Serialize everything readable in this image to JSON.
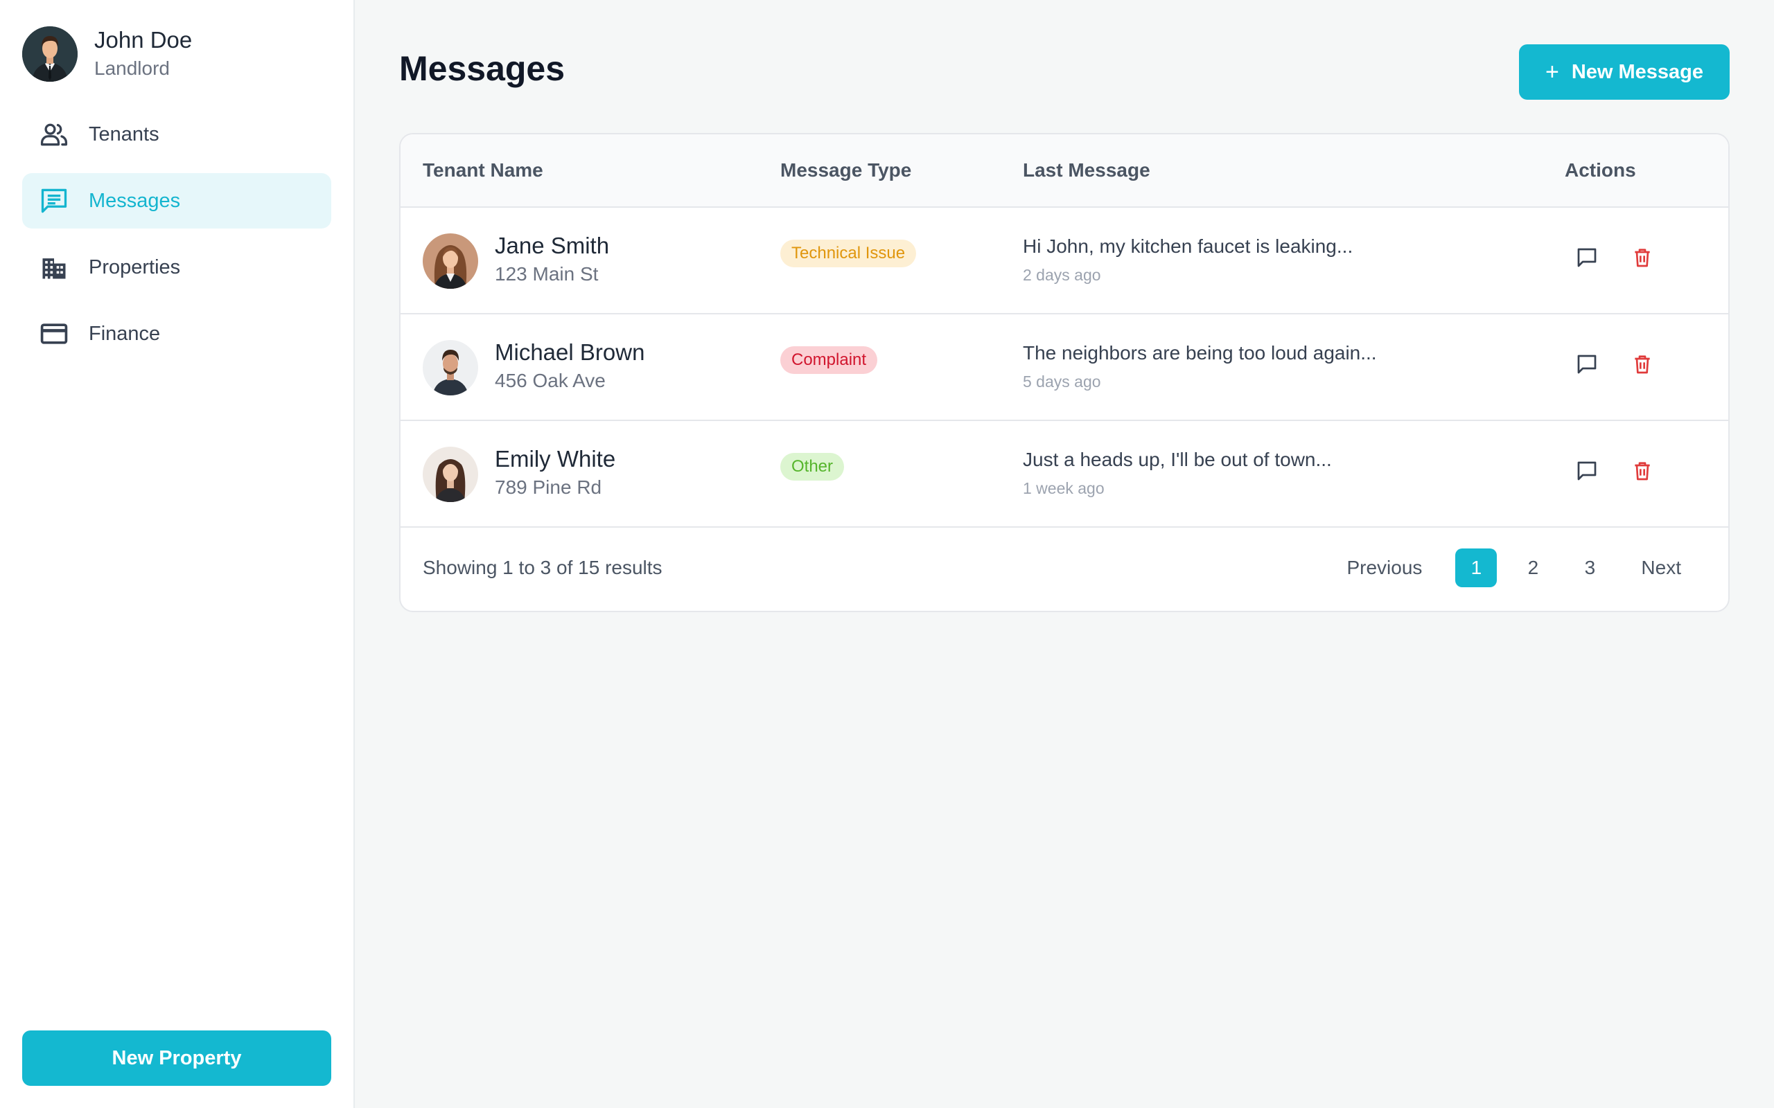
{
  "user": {
    "name": "John Doe",
    "role": "Landlord"
  },
  "sidebar": {
    "items": [
      {
        "label": "Tenants",
        "icon": "users-icon",
        "active": false
      },
      {
        "label": "Messages",
        "icon": "message-icon",
        "active": true
      },
      {
        "label": "Properties",
        "icon": "building-icon",
        "active": false
      },
      {
        "label": "Finance",
        "icon": "credit-card-icon",
        "active": false
      }
    ],
    "new_property_label": "New Property"
  },
  "header": {
    "title": "Messages",
    "new_message_label": "New Message"
  },
  "table": {
    "columns": [
      "Tenant Name",
      "Message Type",
      "Last Message",
      "Actions"
    ],
    "rows": [
      {
        "name": "Jane Smith",
        "address": "123 Main St",
        "type": "Technical Issue",
        "message": "Hi John, my kitchen faucet is leaking...",
        "time": "2 days ago"
      },
      {
        "name": "Michael Brown",
        "address": "456 Oak Ave",
        "type": "Complaint",
        "message": "The neighbors are being too loud again...",
        "time": "5 days ago"
      },
      {
        "name": "Emily White",
        "address": "789 Pine Rd",
        "type": "Other",
        "message": "Just a heads up, I'll be out of town...",
        "time": "1 week ago"
      }
    ]
  },
  "pagination": {
    "summary": "Showing 1 to 3 of 15 results",
    "previous": "Previous",
    "pages": [
      "1",
      "2",
      "3"
    ],
    "current": "1",
    "next": "Next"
  },
  "colors": {
    "accent": "#14b8d0",
    "badge_technical_bg": "#fdefd3",
    "badge_technical_fg": "#e0960d",
    "badge_complaint_bg": "#fbd0d4",
    "badge_complaint_fg": "#d1162e",
    "badge_other_bg": "#dcf5d0",
    "badge_other_fg": "#56b52c",
    "delete": "#e03b3b"
  }
}
